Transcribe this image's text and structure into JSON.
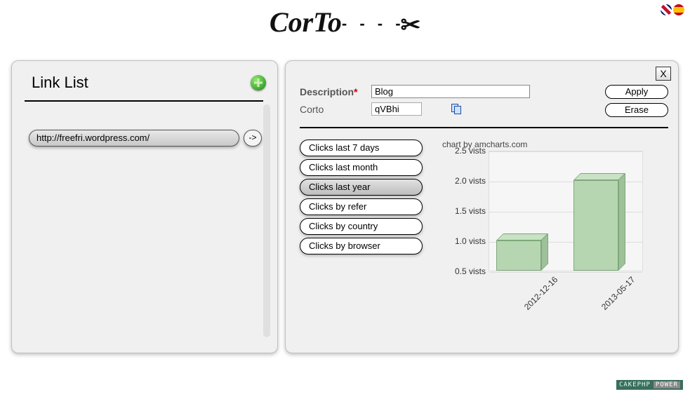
{
  "header": {
    "logo_text": "CorTo",
    "logo_dash": "- - - -"
  },
  "left": {
    "title": "Link List",
    "links": [
      {
        "url": "http://freefri.wordpress.com/",
        "go": "->"
      }
    ]
  },
  "right": {
    "close": "X",
    "description_label": "Description",
    "description_value": "Blog",
    "corto_label": "Corto",
    "corto_value": "qVBhi",
    "apply_label": "Apply",
    "erase_label": "Erase"
  },
  "filters": {
    "items": [
      {
        "label": "Clicks last 7 days",
        "active": false
      },
      {
        "label": "Clicks last month",
        "active": false
      },
      {
        "label": "Clicks last year",
        "active": true
      },
      {
        "label": "Clicks by refer",
        "active": false
      },
      {
        "label": "Clicks by country",
        "active": false
      },
      {
        "label": "Clicks by browser",
        "active": false
      }
    ]
  },
  "chart_data": {
    "type": "bar",
    "credit": "chart by amcharts.com",
    "categories": [
      "2012-12-16",
      "2013-05-17"
    ],
    "values": [
      1.0,
      2.0
    ],
    "ylabel_suffix": "vists",
    "y_ticks": [
      0.5,
      1.0,
      1.5,
      2.0,
      2.5
    ],
    "ylim": [
      0.5,
      2.5
    ]
  },
  "footer": {
    "cake": "CAKEPHP",
    "power": "POWER"
  }
}
